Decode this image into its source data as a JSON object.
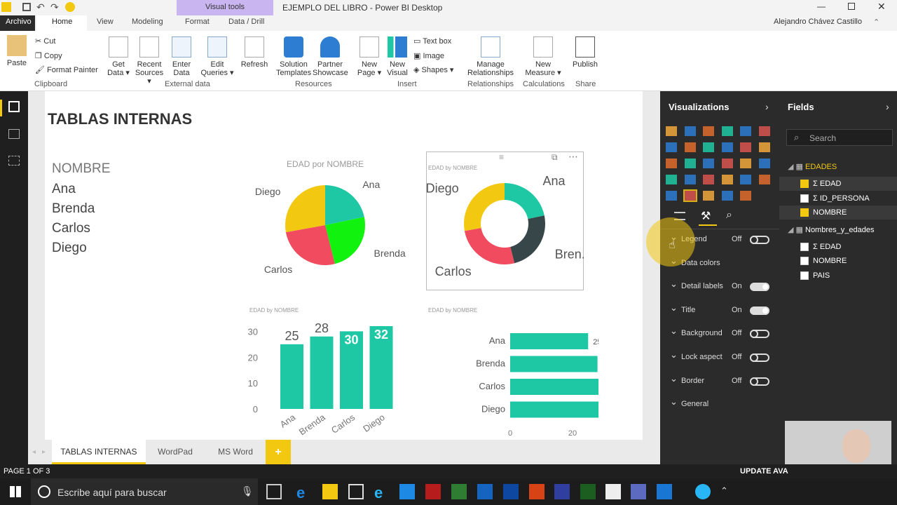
{
  "window": {
    "contextual_tab": "Visual tools",
    "title": "EJEMPLO DEL LIBRO - Power BI Desktop",
    "user": "Alejandro Chávez Castillo"
  },
  "tabs": [
    "Archivo",
    "Home",
    "View",
    "Modeling",
    "Format",
    "Data / Drill"
  ],
  "ribbon": {
    "clipboard": {
      "paste": "Paste",
      "cut": "Cut",
      "copy": "Copy",
      "format_painter": "Format Painter",
      "group": "Clipboard"
    },
    "external": {
      "get_data": "Get",
      "get_data2": "Data",
      "recent": "Recent",
      "recent2": "Sources",
      "enter": "Enter",
      "enter2": "Data",
      "edit": "Edit",
      "edit2": "Queries",
      "refresh": "Refresh",
      "group": "External data"
    },
    "resources": {
      "sol": "Solution",
      "sol2": "Templates",
      "partner": "Partner",
      "partner2": "Showcase",
      "group": "Resources"
    },
    "insert": {
      "newpage": "New",
      "newpage2": "Page",
      "newvisual": "New",
      "newvisual2": "Visual",
      "textbox": "Text box",
      "image": "Image",
      "shapes": "Shapes",
      "group": "Insert"
    },
    "relationships": {
      "manage": "Manage",
      "manage2": "Relationships",
      "group": "Relationships"
    },
    "calculations": {
      "measure": "New",
      "measure2": "Measure",
      "group": "Calculations"
    },
    "share": {
      "publish": "Publish",
      "group": "Share"
    }
  },
  "report": {
    "title": "TABLAS INTERNAS",
    "names": [
      "NOMBRE",
      "Ana",
      "Brenda",
      "Carlos",
      "Diego"
    ]
  },
  "colors": {
    "teal": "#1ec8a5",
    "green": "#12f20f",
    "red": "#f04b5f",
    "yellow": "#f2c811",
    "dark": "#374649",
    "brand": "#f2c811"
  },
  "chart_data": [
    {
      "type": "pie",
      "title": "EDAD por NOMBRE",
      "categories": [
        "Ana",
        "Brenda",
        "Carlos",
        "Diego"
      ],
      "values": [
        25,
        28,
        30,
        32
      ]
    },
    {
      "type": "pie",
      "subtype": "donut",
      "title": "EDAD by NOMBRE",
      "categories": [
        "Ana",
        "Bren...",
        "Carlos",
        "Diego"
      ],
      "values": [
        25,
        28,
        30,
        32
      ]
    },
    {
      "type": "bar",
      "orientation": "vertical",
      "title": "EDAD by NOMBRE",
      "categories": [
        "Ana",
        "Brenda",
        "Carlos",
        "Diego"
      ],
      "values": [
        25,
        28,
        30,
        32
      ],
      "ylim": [
        0,
        32
      ],
      "yticks": [
        "0",
        "10",
        "20",
        "30"
      ]
    },
    {
      "type": "bar",
      "orientation": "horizontal",
      "title": "EDAD by NOMBRE",
      "categories": [
        "Ana",
        "Brenda",
        "Carlos",
        "Diego"
      ],
      "values": [
        25,
        28,
        30,
        32
      ],
      "xlim": [
        0,
        40
      ],
      "xticks": [
        "0",
        "20",
        "40"
      ]
    }
  ],
  "page_tabs": [
    "TABLAS INTERNAS",
    "WordPad",
    "MS Word",
    "+"
  ],
  "status": {
    "page": "PAGE 1 OF 3",
    "update": "UPDATE AVA"
  },
  "visualizations": {
    "header": "Visualizations",
    "format_rows": [
      {
        "label": "Legend",
        "state": "Off",
        "on": false
      },
      {
        "label": "Data colors",
        "state": "",
        "on": null
      },
      {
        "label": "Detail labels",
        "state": "On",
        "on": true
      },
      {
        "label": "Title",
        "state": "On",
        "on": true
      },
      {
        "label": "Background",
        "state": "Off",
        "on": false
      },
      {
        "label": "Lock aspect",
        "state": "Off",
        "on": false
      },
      {
        "label": "Border",
        "state": "Off",
        "on": false
      },
      {
        "label": "General",
        "state": "",
        "on": null
      }
    ]
  },
  "fields": {
    "header": "Fields",
    "search_placeholder": "Search",
    "tables": [
      {
        "name": "EDADES",
        "items": [
          {
            "label": "EDAD",
            "sigma": true,
            "checked": true
          },
          {
            "label": "ID_PERSONA",
            "sigma": true,
            "checked": false
          },
          {
            "label": "NOMBRE",
            "sigma": false,
            "checked": true
          }
        ]
      },
      {
        "name": "Nombres_y_edades",
        "items": [
          {
            "label": "EDAD",
            "sigma": true,
            "checked": false
          },
          {
            "label": "NOMBRE",
            "sigma": false,
            "checked": false
          },
          {
            "label": "PAIS",
            "sigma": false,
            "checked": false
          }
        ]
      }
    ]
  },
  "taskbar": {
    "search": "Escribe aquí para buscar"
  }
}
